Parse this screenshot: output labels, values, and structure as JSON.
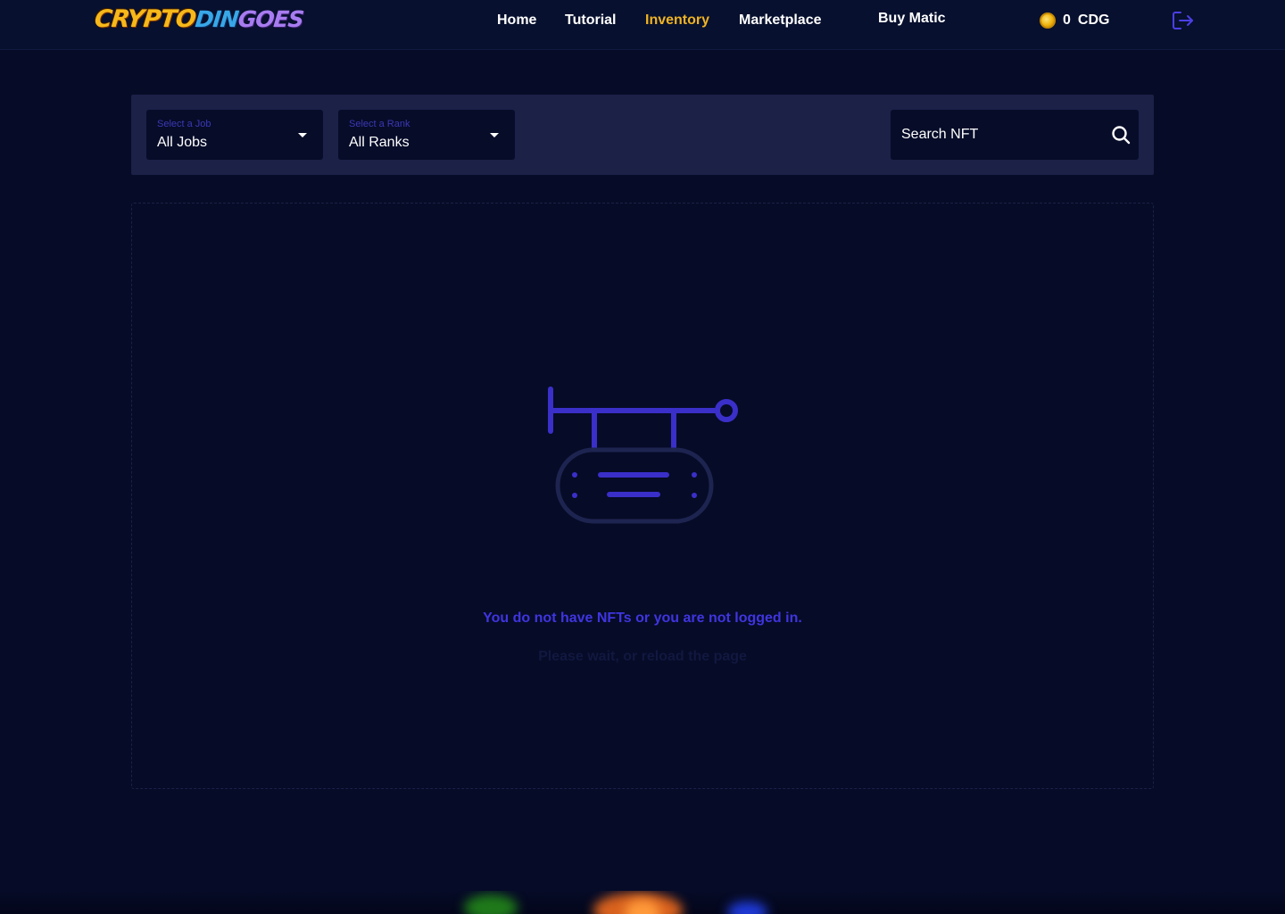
{
  "header": {
    "logo": {
      "part1": "CRYPTO",
      "part2": "DIN",
      "part3": "GOES"
    },
    "nav": [
      {
        "label": "Home",
        "active": false
      },
      {
        "label": "Tutorial",
        "active": false
      },
      {
        "label": "Inventory",
        "active": true
      },
      {
        "label": "Marketplace",
        "active": false
      },
      {
        "label": "Buy Matic",
        "active": false
      }
    ],
    "balance": {
      "amount": "0",
      "currency": "CDG",
      "icon": "coin-icon"
    },
    "logout_icon": "logout-icon"
  },
  "filters": {
    "job": {
      "label": "Select a Job",
      "value": "All Jobs"
    },
    "rank": {
      "label": "Select a Rank",
      "value": "All Ranks"
    },
    "search": {
      "placeholder": "Search NFT",
      "icon": "search-icon"
    }
  },
  "empty_state": {
    "icon": "hanging-sign-icon",
    "title": "You do not have NFTs or you are not logged in.",
    "subtitle": "Please wait, or reload the page"
  },
  "colors": {
    "background": "#060b27",
    "accent": "#f0b323",
    "primary": "#3f35e0",
    "panel": "#1b2147"
  }
}
